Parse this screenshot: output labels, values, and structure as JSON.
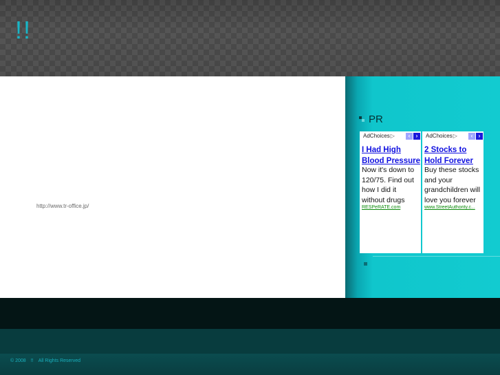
{
  "header": {
    "title": "!!"
  },
  "main": {
    "url_text": "http://www.tr-office.jp/"
  },
  "sidebar": {
    "heading": "PR",
    "ads": [
      {
        "adchoices": "AdChoices",
        "title": "I Had High Blood Pressure",
        "body": "Now it's down to 120/75. Find out how I did it without drugs",
        "source": "RESPeRATE.com"
      },
      {
        "adchoices": "AdChoices",
        "title": "2 Stocks to Hold Forever",
        "body": "Buy these stocks and your grandchildren will love you forever",
        "source": "www.StreetAuthority.c..."
      }
    ]
  },
  "footer": {
    "copyright": "© 2008",
    "site": "!!",
    "rights": "All Rights Reserved"
  },
  "colors": {
    "title": "#18b6c7",
    "sidebar": "#12cbd0",
    "ad_link": "#1010e0",
    "ad_source": "#0a8a0a"
  }
}
